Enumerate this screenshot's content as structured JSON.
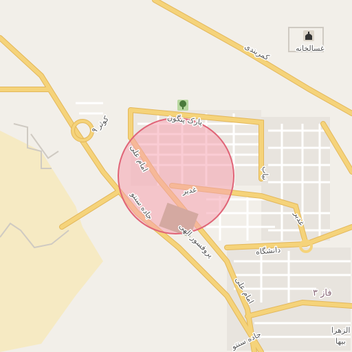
{
  "map": {
    "colors": {
      "background": "#f2efe9",
      "sand": "#f6eac3",
      "block": "#e8e4de",
      "road_main": "#f5d37a",
      "road_casing": "#e3b75a",
      "road_minor": "#ffffff",
      "road_minor_casing": "#d8d2c8",
      "highlight_circle_fill": "#f6a3b1",
      "highlight_circle_stroke": "#e06477",
      "park": "#b8d8a0"
    },
    "labels": {
      "kamarbandi": "کمربندی",
      "ghassalkhaneh": "غسالخانه",
      "park_pangoon": "پارک پنگون",
      "kowsar": "کوثر ۹",
      "emam_ali_1": "امام علی",
      "emam_ali_2": "امام علی",
      "ghadir": "غدیر",
      "nab": "نیاب",
      "ghadir_2": "غدیر",
      "jadeh_sento": "جاده سنتو",
      "jadeh_sento_2": "جاده سنتو",
      "daneshgah": "دانشگاه",
      "profesor": "پروفسور الهی",
      "faz3": "فاز ۳",
      "alzahra": "الزهرا",
      "beha": "بیها"
    },
    "icons": {
      "mosque": "mosque-icon",
      "park": "tree-icon"
    }
  }
}
